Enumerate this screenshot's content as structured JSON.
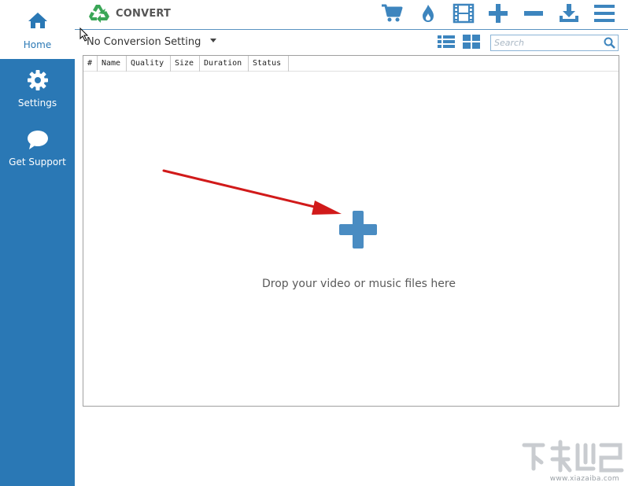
{
  "sidebar": {
    "items": [
      {
        "label": "Home",
        "icon": "home-icon",
        "active": true
      },
      {
        "label": "Settings",
        "icon": "gear-icon",
        "active": false
      },
      {
        "label": "Get Support",
        "icon": "chat-bubble-icon",
        "active": false
      }
    ]
  },
  "header": {
    "title": "CONVERT",
    "logo_icon": "recycle-icon",
    "toolbar": [
      "cart-icon",
      "flame-icon",
      "film-icon",
      "plus-icon",
      "minus-icon",
      "download-icon",
      "menu-icon"
    ]
  },
  "conversion": {
    "selected": "No Conversion Setting"
  },
  "search": {
    "placeholder": "Search"
  },
  "table": {
    "columns": [
      "#",
      "Name",
      "Quality",
      "Size",
      "Duration",
      "Status"
    ]
  },
  "dropzone": {
    "message": "Drop your video or music files here"
  },
  "watermark": {
    "text": "www.xiazaiba.com"
  },
  "colors": {
    "accent": "#2a78b5",
    "icon": "#3d85be",
    "logo_green": "#3aa657",
    "arrow_red": "#d11a1a"
  }
}
